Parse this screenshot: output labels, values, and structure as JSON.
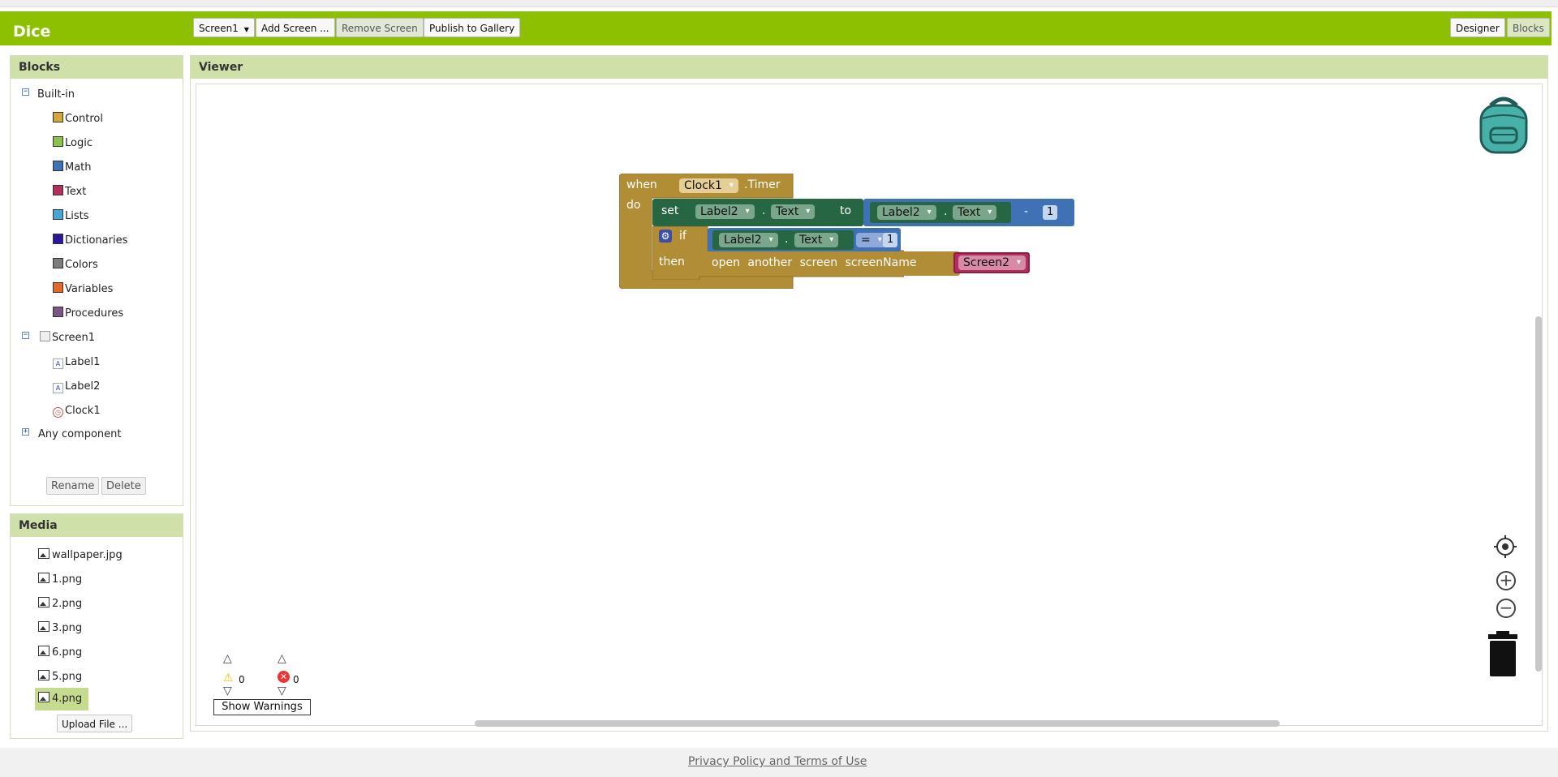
{
  "app": {
    "title": "Dice"
  },
  "toolbar": {
    "screen_select": "Screen1",
    "add_screen": "Add Screen ...",
    "remove_screen": "Remove Screen",
    "publish": "Publish to Gallery",
    "designer": "Designer",
    "blocks": "Blocks"
  },
  "blocks_panel": {
    "title": "Blocks",
    "builtin_label": "Built-in",
    "builtin": [
      {
        "label": "Control",
        "color": "#d5a43a"
      },
      {
        "label": "Logic",
        "color": "#8bc34a"
      },
      {
        "label": "Math",
        "color": "#3f71b5"
      },
      {
        "label": "Text",
        "color": "#b32d5e"
      },
      {
        "label": "Lists",
        "color": "#49a6d4"
      },
      {
        "label": "Dictionaries",
        "color": "#2d1799"
      },
      {
        "label": "Colors",
        "color": "#7d7d7d"
      },
      {
        "label": "Variables",
        "color": "#e56829"
      },
      {
        "label": "Procedures",
        "color": "#7c5385"
      }
    ],
    "screen_label": "Screen1",
    "components": [
      "Label1",
      "Label2",
      "Clock1"
    ],
    "any_component": "Any component",
    "rename": "Rename",
    "delete": "Delete"
  },
  "media_panel": {
    "title": "Media",
    "files": [
      "wallpaper.jpg",
      "1.png",
      "2.png",
      "3.png",
      "6.png",
      "5.png",
      "4.png"
    ],
    "selected": "4.png",
    "upload": "Upload File ..."
  },
  "viewer": {
    "title": "Viewer",
    "warnings_count": "0",
    "errors_count": "0",
    "show_warnings": "Show Warnings"
  },
  "code": {
    "when": "when",
    "clock": "Clock1",
    "timer": ".Timer",
    "do": "do",
    "set": "set",
    "label2": "Label2",
    "dot": ".",
    "text_prop": "Text",
    "to": "to",
    "minus": "-",
    "one": "1",
    "if": "if",
    "eq": "=",
    "then": "then",
    "open": "open",
    "another": "another",
    "screen": "screen",
    "screenName": "screenName",
    "screen2": "Screen2"
  },
  "footer": {
    "link": "Privacy Policy and Terms of Use"
  },
  "colors": {
    "accent": "#8dc000",
    "control": "#b18e35",
    "setter": "#266643",
    "math": "#3f71b5",
    "text": "#b32d5e"
  }
}
